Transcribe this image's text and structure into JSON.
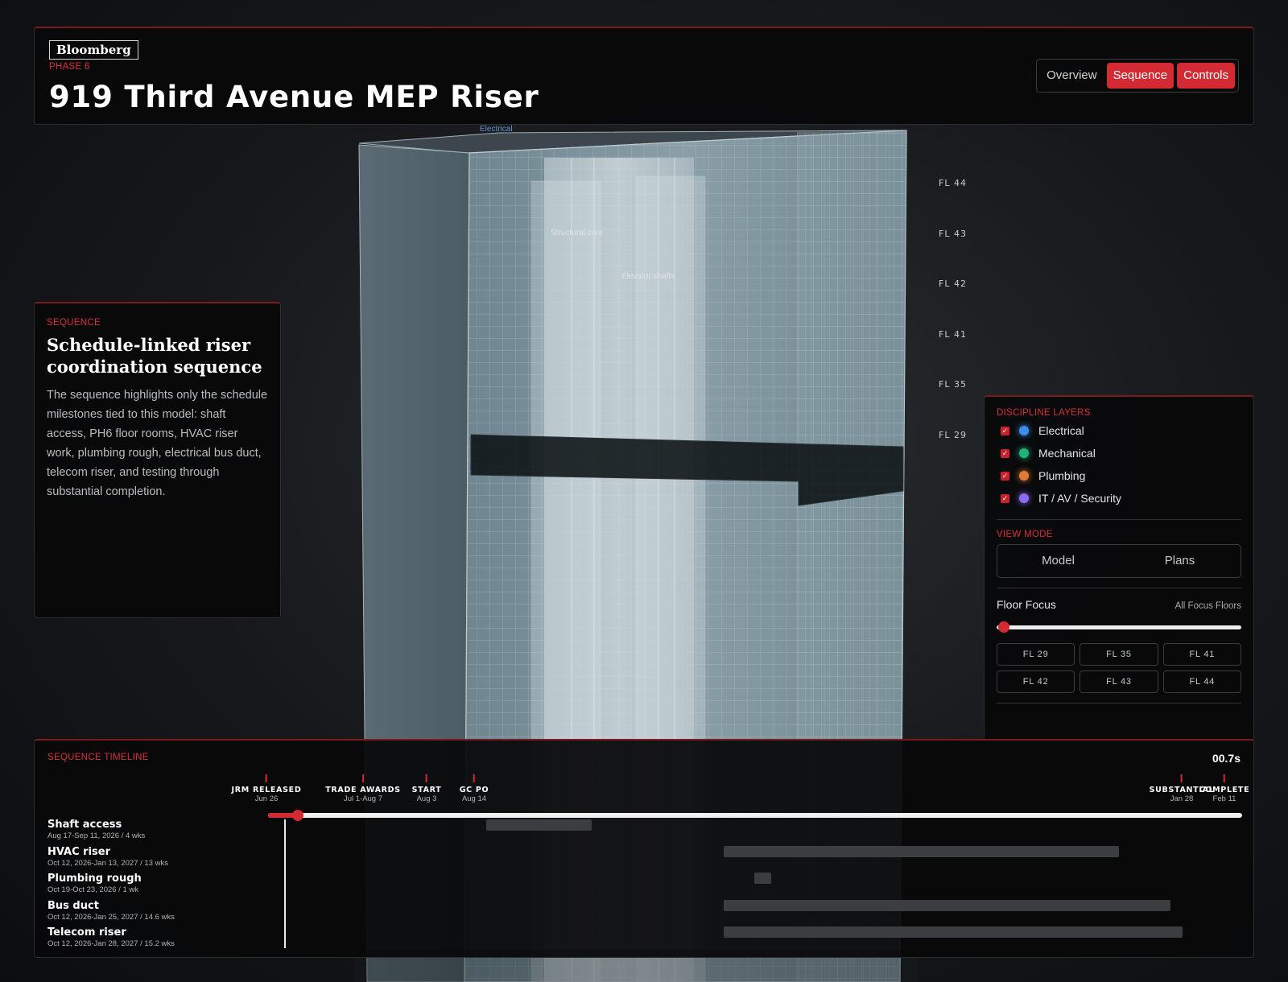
{
  "header": {
    "logo": "Bloomberg",
    "phase": "PHASE 6",
    "title": "919 Third Avenue MEP Riser",
    "tabs": [
      {
        "label": "Overview",
        "active": false
      },
      {
        "label": "Sequence",
        "active": true
      },
      {
        "label": "Controls",
        "active": true
      }
    ]
  },
  "model": {
    "tags": {
      "electrical": "Electrical",
      "structural_core": "Structural core",
      "elevator_shafts": "Elevator shafts"
    },
    "floor_labels": [
      "FL 44",
      "FL 43",
      "FL 42",
      "FL 41",
      "FL 35",
      "FL 29"
    ]
  },
  "sequence_card": {
    "eyebrow": "SEQUENCE",
    "heading": "Schedule-linked riser coordination sequence",
    "body": "The sequence highlights only the schedule milestones tied to this model: shaft access, PH6 floor rooms, HVAC riser work, plumbing rough, electrical bus duct, telecom riser, and testing through substantial completion."
  },
  "controls": {
    "layers_title": "DISCIPLINE LAYERS",
    "layers": [
      {
        "label": "Electrical",
        "color": "#3b8eea",
        "checked": true
      },
      {
        "label": "Mechanical",
        "color": "#1fb57a",
        "checked": true
      },
      {
        "label": "Plumbing",
        "color": "#e07b39",
        "checked": true
      },
      {
        "label": "IT / AV / Security",
        "color": "#8b6cf0",
        "checked": true
      }
    ],
    "view_mode_title": "VIEW MODE",
    "view_modes": [
      "Model",
      "Plans"
    ],
    "floor_focus_label": "Floor Focus",
    "floor_focus_value": "All Focus Floors",
    "floor_focus_level": 0,
    "floor_buttons": [
      "FL 29",
      "FL 35",
      "FL 41",
      "FL 42",
      "FL 43",
      "FL 44"
    ]
  },
  "timeline": {
    "title": "SEQUENCE TIMELINE",
    "time": "00.7s",
    "progress": 0.02,
    "milestones": [
      {
        "name": "JRM RELEASED",
        "date": "Jun 26"
      },
      {
        "name": "TRADE AWARDS",
        "date": "Jul 1-Aug 7"
      },
      {
        "name": "START",
        "date": "Aug 3"
      },
      {
        "name": "GC PO",
        "date": "Aug 14"
      },
      {
        "name": "SUBSTANTIAL",
        "date": "Jan 28"
      },
      {
        "name": "COMPLETE",
        "date": "Feb 11"
      }
    ],
    "tasks": [
      {
        "name": "Shaft access",
        "dates": "Aug 17-Sep 11, 2026 / 4 wks"
      },
      {
        "name": "HVAC riser",
        "dates": "Oct 12, 2026-Jan 13, 2027 / 13 wks"
      },
      {
        "name": "Plumbing rough",
        "dates": "Oct 19-Oct 23, 2026 / 1 wk"
      },
      {
        "name": "Bus duct",
        "dates": "Oct 12, 2026-Jan 25, 2027 / 14.6 wks"
      },
      {
        "name": "Telecom riser",
        "dates": "Oct 12, 2026-Jan 28, 2027 / 15.2 wks"
      }
    ]
  }
}
